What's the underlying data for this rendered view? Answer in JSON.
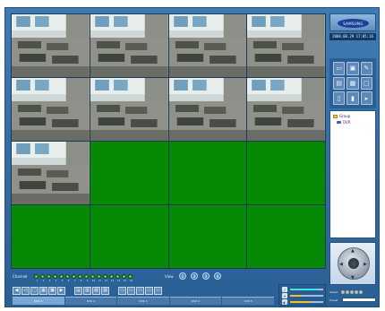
{
  "header": {
    "brand": "SAMSUNG",
    "datetime": "2008.08.29 17:05:16"
  },
  "video_grid": {
    "camera_cells": 9,
    "empty_cells": 7,
    "empty_color": "#068a06"
  },
  "toolbar_icons": [
    "video-icon",
    "record-icon",
    "settings-icon",
    "monitor-icon",
    "save-icon",
    "window-icon",
    "document-icon",
    "tools-icon"
  ],
  "tree": {
    "root": "Group",
    "child": "DVR"
  },
  "channels": {
    "label": "Channel",
    "items": [
      "1",
      "2",
      "3",
      "4",
      "5",
      "6",
      "7",
      "8",
      "9",
      "10",
      "11",
      "12",
      "13",
      "14",
      "15",
      "16"
    ]
  },
  "views": {
    "label": "View",
    "items": [
      "1",
      "2",
      "3",
      "4"
    ]
  },
  "tabs": [
    {
      "label": "DVR 1"
    },
    {
      "label": "DVR 2"
    },
    {
      "label": "DVR 3"
    },
    {
      "label": "DVR 4"
    },
    {
      "label": "DVR 5"
    }
  ],
  "ptz": {
    "speed_label": "Speed",
    "preset_label": "Preset",
    "speed_levels": 5,
    "speed_active": 5
  },
  "levels": {
    "volume": 0.85,
    "brightness": 0.35,
    "contrast": 0.65
  },
  "colors": {
    "frame": "#3f7bb3",
    "channel_on": "#2fbf2f",
    "accent": "#44e0e7"
  }
}
